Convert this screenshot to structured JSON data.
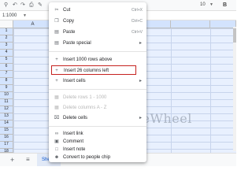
{
  "toolbar": {
    "icons": [
      "search-icon",
      "undo-icon",
      "redo-icon",
      "print-icon",
      "paint-format-icon"
    ],
    "font_size": "10",
    "bold_label": "B"
  },
  "formula_bar": {
    "name_box": "1:1000"
  },
  "grid": {
    "columns": [
      "A",
      "",
      "",
      "",
      "",
      ""
    ],
    "rows": [
      "1",
      "2",
      "3",
      "4",
      "5",
      "6",
      "7",
      "8",
      "9",
      "10",
      "11",
      "12",
      "13",
      "14",
      "15",
      "16",
      "17",
      "18"
    ]
  },
  "context_menu": {
    "items": [
      {
        "icon": "scissors-icon",
        "label": "Cut",
        "shortcut": "Ctrl+X"
      },
      {
        "icon": "copy-icon",
        "label": "Copy",
        "shortcut": "Ctrl+C"
      },
      {
        "icon": "clipboard-icon",
        "label": "Paste",
        "shortcut": "Ctrl+V"
      },
      {
        "icon": "clipboard-icon",
        "label": "Paste special",
        "shortcut": ""
      },
      {
        "icon": "plus-icon",
        "label": "Insert 1000 rows above",
        "shortcut": ""
      },
      {
        "icon": "plus-icon",
        "label": "Insert 26 columns left",
        "shortcut": ""
      },
      {
        "icon": "plus-icon",
        "label": "Insert cells",
        "shortcut": ""
      },
      {
        "icon": "trash-icon",
        "label": "Delete rows 1 - 1000",
        "shortcut": ""
      },
      {
        "icon": "trash-icon",
        "label": "Delete columns A - Z",
        "shortcut": ""
      },
      {
        "icon": "x-box-icon",
        "label": "Delete cells",
        "shortcut": ""
      },
      {
        "icon": "link-icon",
        "label": "Insert link",
        "shortcut": ""
      },
      {
        "icon": "comment-icon",
        "label": "Comment",
        "shortcut": ""
      },
      {
        "icon": "note-icon",
        "label": "Insert note",
        "shortcut": ""
      },
      {
        "icon": "people-chip-icon",
        "label": "Convert to people chip",
        "shortcut": ""
      }
    ]
  },
  "watermark": {
    "text": "OfficeWheel"
  },
  "bottom_bar": {
    "add_sheet": "+",
    "all_sheets": "≡",
    "sheet_tab": "Shee"
  },
  "colors": {
    "selection": "#e8f0fe",
    "header_selected": "#d3e3fd",
    "highlight_border": "#c5221f"
  }
}
